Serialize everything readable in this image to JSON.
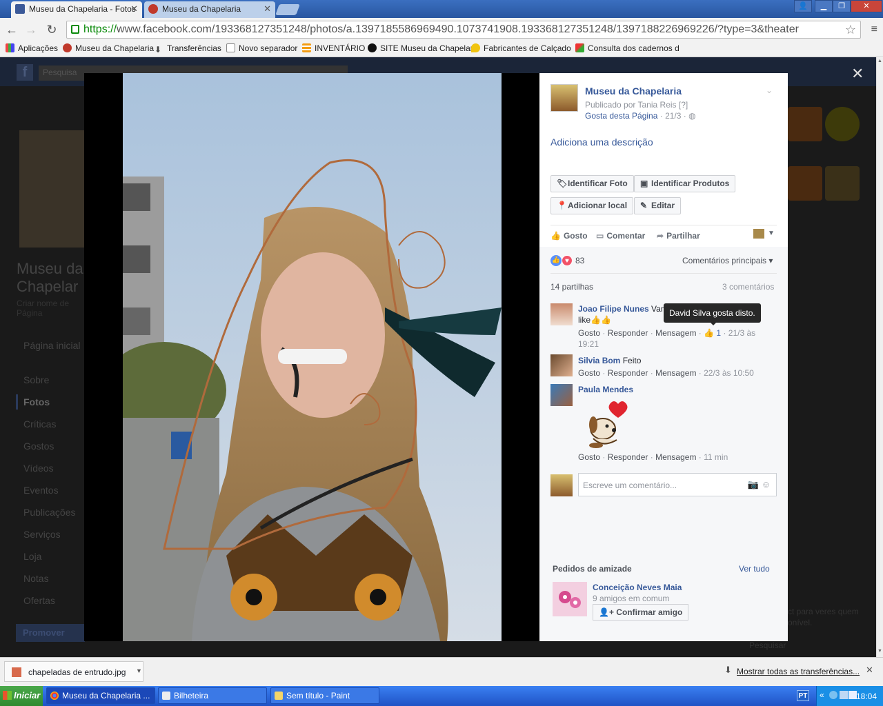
{
  "browser": {
    "tabs": [
      {
        "title": "Museu da Chapelaria - Fotos",
        "active": true
      },
      {
        "title": "Museu da Chapelaria",
        "active": false
      }
    ],
    "url_https": "https://",
    "url_rest": "www.facebook.com/193368127351248/photos/a.1397185586969490.1073741908.193368127351248/1397188226969226/?type=3&theater",
    "bookmarks": [
      "Aplicações",
      "Museu da Chapelaria",
      "Transferências",
      "Novo separador",
      "INVENTÁRIO",
      "SITE Museu da Chapelar",
      "Fabricantes de Calçado",
      "Consulta dos cadernos d"
    ]
  },
  "background_page": {
    "search_placeholder": "Pesquisa",
    "page_title_1": "Museu da",
    "page_title_2": "Chapelar",
    "create_username": "Criar nome de Página",
    "nav": [
      "Página inicial",
      "Sobre",
      "Fotos",
      "Críticas",
      "Gostos",
      "Vídeos",
      "Eventos",
      "Publicações",
      "Serviços",
      "Loja",
      "Notas",
      "Ofertas"
    ],
    "promote": "Promover",
    "right_text_1": "ct para veres quem",
    "right_text_2": "onível.",
    "right_text_3": "Pesquisar"
  },
  "post": {
    "page_name": "Museu da Chapelaria",
    "published_by": "Publicado por Tania Reis [?]",
    "like_page": "Gosta desta Página",
    "date_meta": "· 21/3 ·",
    "add_description": "Adiciona uma descrição",
    "buttons": {
      "tag_photo": "Identificar Foto",
      "tag_products": "Identificar Produtos",
      "add_location": "Adicionar local",
      "edit": "Editar"
    },
    "actions": {
      "like": "Gosto",
      "comment": "Comentar",
      "share": "Partilhar"
    },
    "reaction_count": "83",
    "sort_label": "Comentários principais",
    "shares": "14 partilhas",
    "comments_count": "3 comentários"
  },
  "comments": [
    {
      "author": "Joao Filipe Nunes",
      "text": "Vam",
      "text_line2": "like👍👍",
      "like_label": "Gosto",
      "reply_label": "Responder",
      "message_label": "Mensagem",
      "likes": "1",
      "time": "· 21/3 às",
      "time2": "19:21"
    },
    {
      "author": "Silvia Bom",
      "text": "Feito",
      "like_label": "Gosto",
      "reply_label": "Responder",
      "message_label": "Mensagem",
      "time": "· 22/3 às 10:50"
    },
    {
      "author": "Paula Mendes",
      "text": "",
      "like_label": "Gosto",
      "reply_label": "Responder",
      "message_label": "Mensagem",
      "time": "· 11 min"
    }
  ],
  "tooltip": "David Silva gosta disto.",
  "comment_box_placeholder": "Escreve um comentário...",
  "friend_requests": {
    "heading": "Pedidos de amizade",
    "see_all": "Ver tudo",
    "name": "Conceição Neves Maia",
    "mutual": "9 amigos em comum",
    "confirm": "Confirmar amigo"
  },
  "download_bar": {
    "file": "chapeladas de entrudo.jpg",
    "show_all": "Mostrar todas as transferências..."
  },
  "taskbar": {
    "start": "Iniciar",
    "items": [
      "Museu da Chapelaria ...",
      "Bilheteira",
      "Sem título - Paint"
    ],
    "lang": "PT",
    "time": "18:04"
  }
}
